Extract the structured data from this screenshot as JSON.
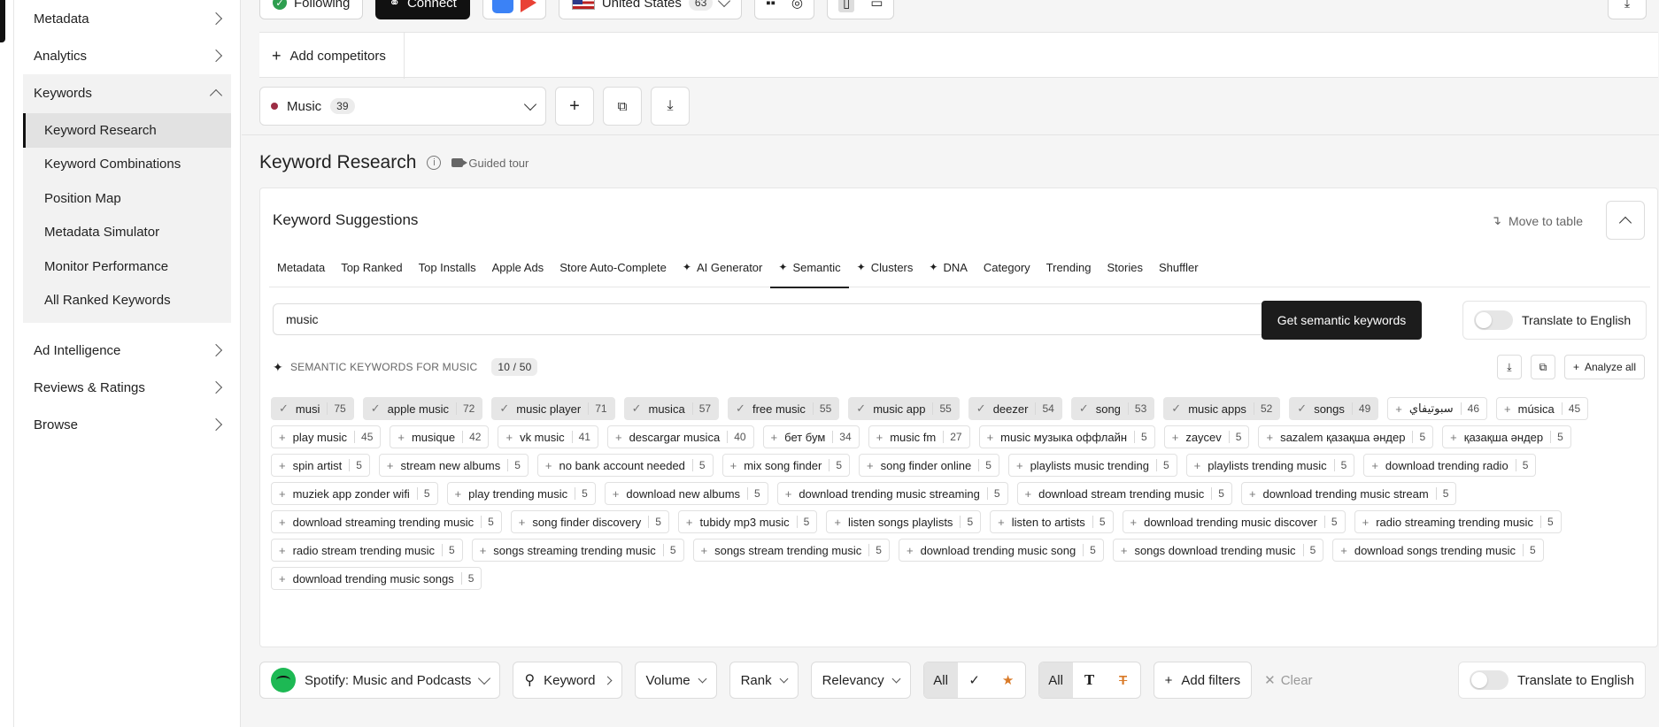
{
  "sidebar": {
    "groups_top": [
      {
        "label": "Metadata"
      },
      {
        "label": "Analytics"
      }
    ],
    "keywords_label": "Keywords",
    "keyword_items": [
      {
        "label": "Keyword Research"
      },
      {
        "label": "Keyword Combinations"
      },
      {
        "label": "Position Map"
      },
      {
        "label": "Metadata Simulator"
      },
      {
        "label": "Monitor Performance"
      },
      {
        "label": "All Ranked Keywords"
      }
    ],
    "groups_bottom": [
      {
        "label": "Ad Intelligence"
      },
      {
        "label": "Reviews & Ratings"
      },
      {
        "label": "Browse"
      }
    ]
  },
  "topbar": {
    "following_label": "Following",
    "connect_label": "Connect",
    "country_label": "United States",
    "country_count": "63"
  },
  "competitors": {
    "add_label": "Add competitors"
  },
  "list_selector": {
    "name": "Music",
    "count": "39"
  },
  "page": {
    "title": "Keyword Research",
    "guided_tour": "Guided tour"
  },
  "suggestions": {
    "title": "Keyword Suggestions",
    "move_to_table": "Move to table",
    "tabs": [
      {
        "label": "Metadata",
        "ai": false
      },
      {
        "label": "Top Ranked",
        "ai": false
      },
      {
        "label": "Top Installs",
        "ai": false
      },
      {
        "label": "Apple Ads",
        "ai": false
      },
      {
        "label": "Store Auto-Complete",
        "ai": false
      },
      {
        "label": "AI Generator",
        "ai": true
      },
      {
        "label": "Semantic",
        "ai": true,
        "active": true
      },
      {
        "label": "Clusters",
        "ai": true
      },
      {
        "label": "DNA",
        "ai": true
      },
      {
        "label": "Category",
        "ai": false
      },
      {
        "label": "Trending",
        "ai": false
      },
      {
        "label": "Stories",
        "ai": false
      },
      {
        "label": "Shuffler",
        "ai": false
      }
    ],
    "search_value": "music",
    "get_button": "Get semantic keywords",
    "translate_label": "Translate to English",
    "semantic_header": "SEMANTIC KEYWORDS FOR MUSIC",
    "semantic_count": "10 / 50",
    "analyze_all": "Analyze all",
    "keywords": [
      {
        "text": "musi",
        "value": "75",
        "selected": true
      },
      {
        "text": "apple music",
        "value": "72",
        "selected": true
      },
      {
        "text": "music player",
        "value": "71",
        "selected": true
      },
      {
        "text": "musica",
        "value": "57",
        "selected": true
      },
      {
        "text": "free music",
        "value": "55",
        "selected": true
      },
      {
        "text": "music app",
        "value": "55",
        "selected": true
      },
      {
        "text": "deezer",
        "value": "54",
        "selected": true
      },
      {
        "text": "song",
        "value": "53",
        "selected": true
      },
      {
        "text": "music apps",
        "value": "52",
        "selected": true
      },
      {
        "text": "songs",
        "value": "49",
        "selected": true
      },
      {
        "text": "سبوتيفاي",
        "value": "46",
        "selected": false
      },
      {
        "text": "música",
        "value": "45",
        "selected": false
      },
      {
        "text": "play music",
        "value": "45",
        "selected": false
      },
      {
        "text": "musique",
        "value": "42",
        "selected": false
      },
      {
        "text": "vk music",
        "value": "41",
        "selected": false
      },
      {
        "text": "descargar musica",
        "value": "40",
        "selected": false
      },
      {
        "text": "бет бум",
        "value": "34",
        "selected": false
      },
      {
        "text": "music fm",
        "value": "27",
        "selected": false
      },
      {
        "text": "music музыка оффлайн",
        "value": "5",
        "selected": false
      },
      {
        "text": "zaycev",
        "value": "5",
        "selected": false
      },
      {
        "text": "sazalem қазақша әндер",
        "value": "5",
        "selected": false
      },
      {
        "text": "қазақша әндер",
        "value": "5",
        "selected": false
      },
      {
        "text": "spin artist",
        "value": "5",
        "selected": false
      },
      {
        "text": "stream new albums",
        "value": "5",
        "selected": false
      },
      {
        "text": "no bank account needed",
        "value": "5",
        "selected": false
      },
      {
        "text": "mix song finder",
        "value": "5",
        "selected": false
      },
      {
        "text": "song finder online",
        "value": "5",
        "selected": false
      },
      {
        "text": "playlists music trending",
        "value": "5",
        "selected": false
      },
      {
        "text": "playlists trending music",
        "value": "5",
        "selected": false
      },
      {
        "text": "download trending radio",
        "value": "5",
        "selected": false
      },
      {
        "text": "muziek app zonder wifi",
        "value": "5",
        "selected": false
      },
      {
        "text": "play trending music",
        "value": "5",
        "selected": false
      },
      {
        "text": "download new albums",
        "value": "5",
        "selected": false
      },
      {
        "text": "download trending music streaming",
        "value": "5",
        "selected": false
      },
      {
        "text": "download stream trending music",
        "value": "5",
        "selected": false
      },
      {
        "text": "download trending music stream",
        "value": "5",
        "selected": false
      },
      {
        "text": "download streaming trending music",
        "value": "5",
        "selected": false
      },
      {
        "text": "song finder discovery",
        "value": "5",
        "selected": false
      },
      {
        "text": "tubidy mp3 music",
        "value": "5",
        "selected": false
      },
      {
        "text": "listen songs playlists",
        "value": "5",
        "selected": false
      },
      {
        "text": "listen to artists",
        "value": "5",
        "selected": false
      },
      {
        "text": "download trending music discover",
        "value": "5",
        "selected": false
      },
      {
        "text": "radio streaming trending music",
        "value": "5",
        "selected": false
      },
      {
        "text": "radio stream trending music",
        "value": "5",
        "selected": false
      },
      {
        "text": "songs streaming trending music",
        "value": "5",
        "selected": false
      },
      {
        "text": "songs stream trending music",
        "value": "5",
        "selected": false
      },
      {
        "text": "download trending music song",
        "value": "5",
        "selected": false
      },
      {
        "text": "songs download trending music",
        "value": "5",
        "selected": false
      },
      {
        "text": "download songs trending music",
        "value": "5",
        "selected": false
      },
      {
        "text": "download trending music songs",
        "value": "5",
        "selected": false
      }
    ]
  },
  "filters": {
    "app_label": "Spotify: Music and Podcasts",
    "keyword_label": "Keyword",
    "volume_label": "Volume",
    "rank_label": "Rank",
    "relevancy_label": "Relevancy",
    "all_label_1": "All",
    "all_label_2": "All",
    "add_filters": "Add filters",
    "clear": "Clear",
    "translate_label": "Translate to English"
  },
  "colors": {
    "active_tab_underline": "#222222",
    "list_dot": "#9c2d44",
    "star": "#d97a28",
    "spotify": "#1db954"
  }
}
